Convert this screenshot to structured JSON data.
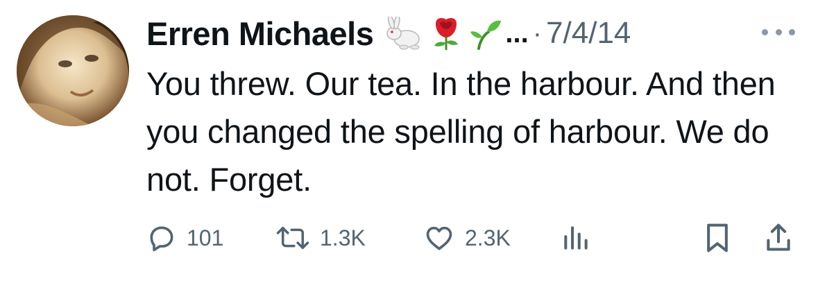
{
  "tweet": {
    "author": {
      "display_name": "Erren Michaels",
      "emojis": [
        "rabbit-emoji",
        "rose-emoji",
        "seedling-emoji"
      ],
      "truncation": "...",
      "separator": "·"
    },
    "date": "7/4/14",
    "text": "You threw. Our tea. In the harbour. And then you changed the spelling of harbour. We do not. Forget.",
    "metrics": {
      "replies": "101",
      "retweets": "1.3K",
      "likes": "2.3K"
    }
  },
  "colors": {
    "text": "#0f1419",
    "muted": "#536471",
    "background": "#ffffff"
  },
  "icons": [
    "reply-icon",
    "retweet-icon",
    "like-icon",
    "views-icon",
    "bookmark-icon",
    "share-icon",
    "more-icon"
  ]
}
